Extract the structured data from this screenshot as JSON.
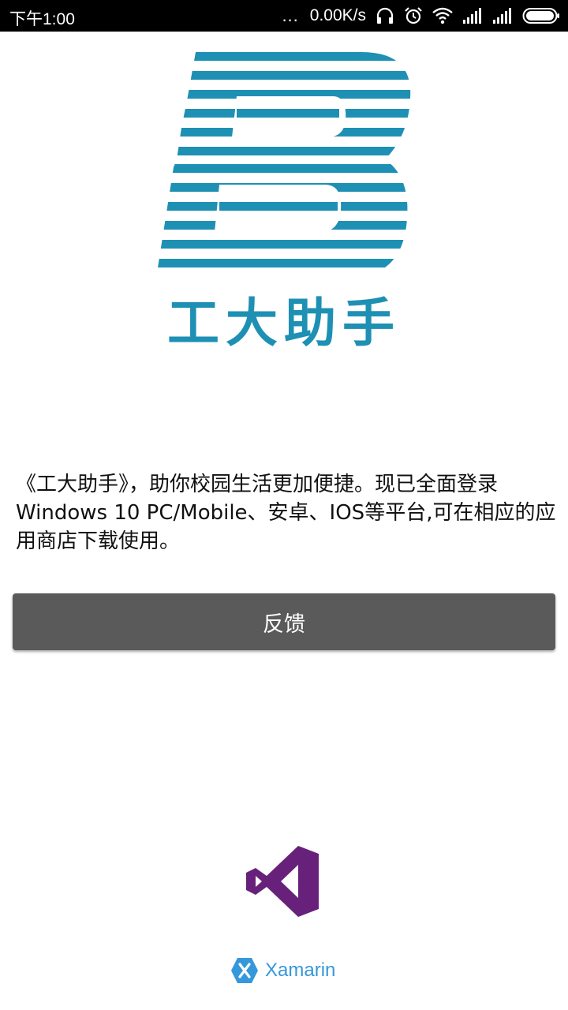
{
  "status_bar": {
    "time": "下午1:00",
    "more": "...",
    "network_speed": "0.00K/s",
    "icons": [
      "headset-icon",
      "alarm-icon",
      "wifi-icon",
      "signal-icon",
      "signal-icon",
      "battery-icon"
    ]
  },
  "app": {
    "logo_icon": "b-stripes-logo",
    "name": "工大助手",
    "brand_color": "#1e90b4"
  },
  "description": "《工大助手》，助你校园生活更加便捷。现已全面登录Windows 10 PC/Mobile、安卓、IOS等平台,可在相应的应用商店下载使用。",
  "feedback_button": {
    "label": "反馈",
    "color": "#5a5a5a"
  },
  "footer": {
    "vs_logo_icon": "visual-studio-icon",
    "vs_color": "#68217a",
    "xamarin_icon": "xamarin-icon",
    "xamarin_label": "Xamarin",
    "xamarin_color": "#3598db"
  }
}
